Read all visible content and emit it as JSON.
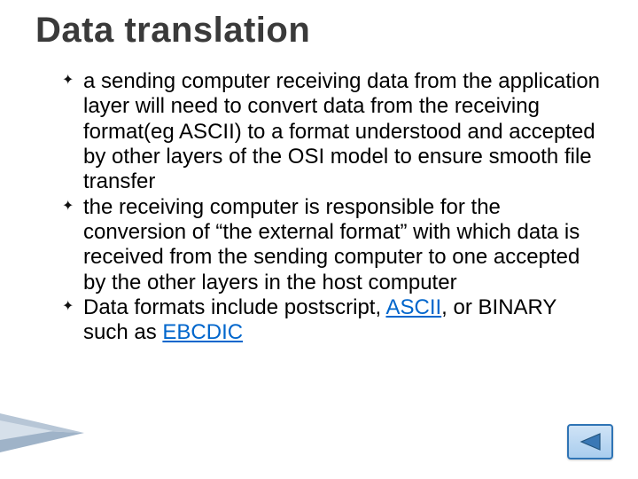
{
  "title": "Data translation",
  "bullets": [
    {
      "segments": [
        {
          "text": "a sending computer receiving data from the application layer will need to convert data from the receiving format(eg ASCII) to a format understood and accepted by other layers of the OSI model to ensure smooth file transfer",
          "link": false
        }
      ]
    },
    {
      "segments": [
        {
          "text": "the receiving computer is responsible for the conversion of “the external format” with which data is received from the sending computer to one accepted by the other layers in the host computer",
          "link": false
        }
      ]
    },
    {
      "segments": [
        {
          "text": "Data formats include postscript, ",
          "link": false
        },
        {
          "text": "ASCII",
          "link": true
        },
        {
          "text": ", or BINARY such as ",
          "link": false
        },
        {
          "text": "EBCDIC",
          "link": true
        }
      ]
    }
  ],
  "bullet_glyph": "✦",
  "nav": {
    "back_label": "back"
  }
}
